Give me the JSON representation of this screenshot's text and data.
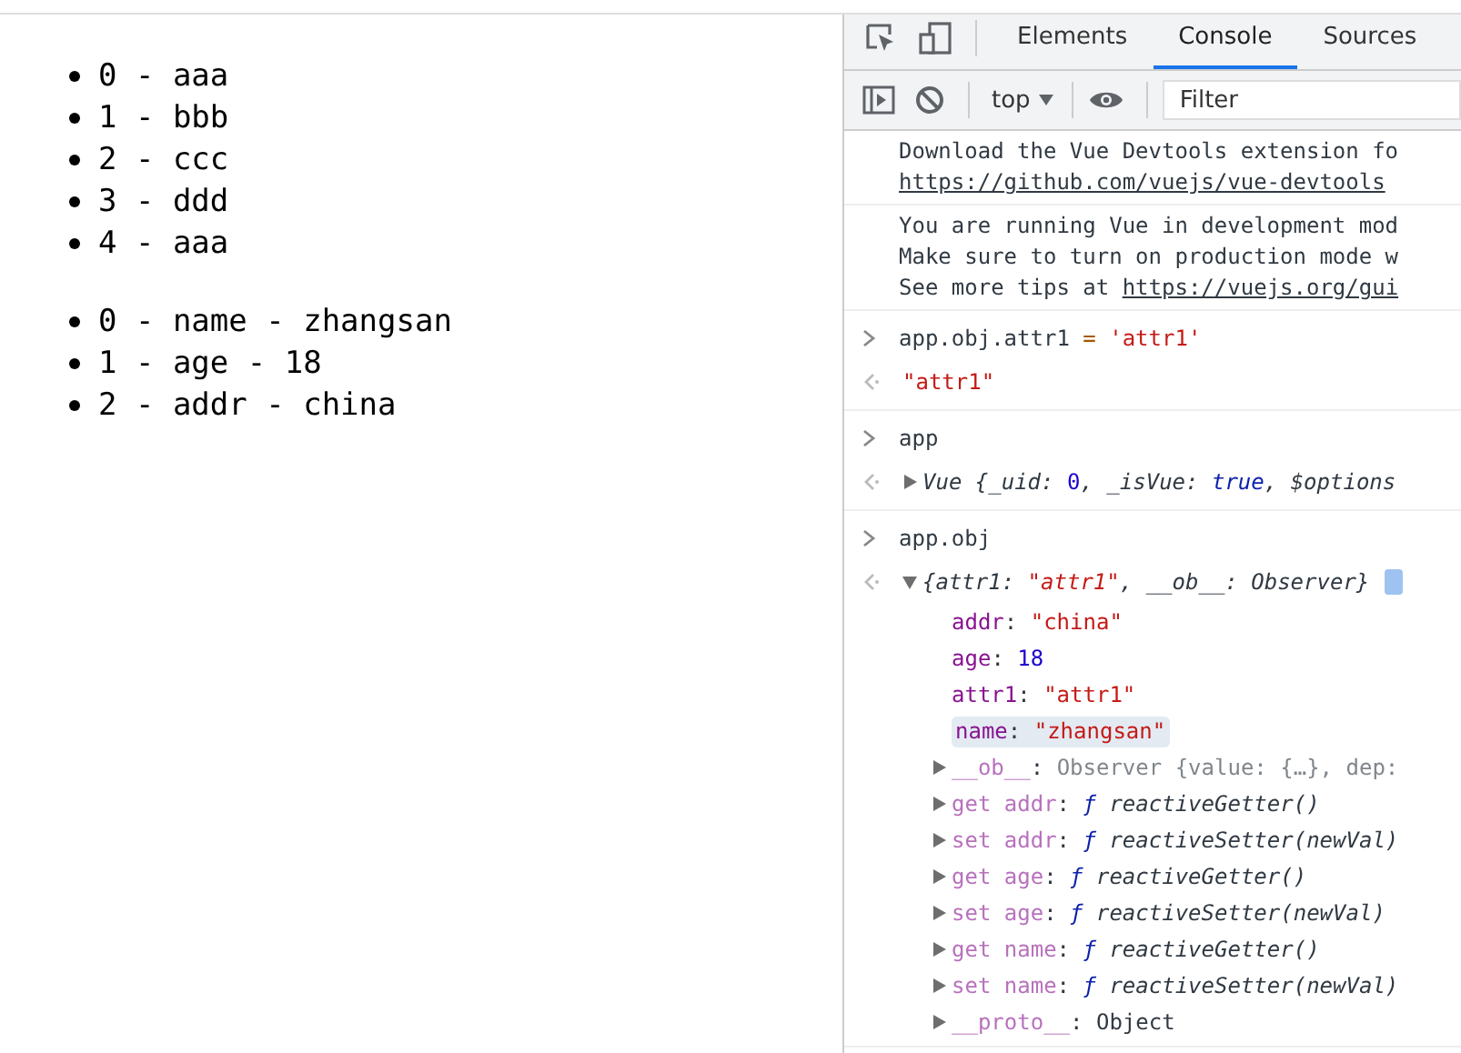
{
  "page": {
    "lists": [
      [
        "0 - aaa",
        "1 - bbb",
        "2 - ccc",
        "3 - ddd",
        "4 - aaa"
      ],
      [
        "0 - name - zhangsan",
        "1 - age - 18",
        "2 - addr - china"
      ]
    ]
  },
  "devtools": {
    "tabs": [
      {
        "label": "Elements",
        "selected": false
      },
      {
        "label": "Console",
        "selected": true
      },
      {
        "label": "Sources",
        "selected": false
      }
    ],
    "context": "top",
    "filter": {
      "placeholder": "Filter"
    },
    "entries": [
      {
        "kind": "message",
        "lines": [
          [
            {
              "kind": "plain",
              "text": "Download the Vue Devtools extension fo"
            }
          ],
          [
            {
              "kind": "link",
              "text": "https://github.com/vuejs/vue-devtools"
            }
          ]
        ]
      },
      {
        "kind": "message",
        "lines": [
          [
            {
              "kind": "plain",
              "text": "You are running Vue in development mod"
            }
          ],
          [
            {
              "kind": "plain",
              "text": "Make sure to turn on production mode w"
            }
          ],
          [
            {
              "kind": "plain",
              "text": "See more tips at "
            },
            {
              "kind": "link",
              "text": "https://vuejs.org/gui"
            }
          ]
        ]
      },
      {
        "kind": "command",
        "input": [
          {
            "kind": "plain",
            "text": "app.obj.attr1 "
          },
          {
            "kind": "operator",
            "text": "= "
          },
          {
            "kind": "string",
            "text": "'attr1'"
          }
        ],
        "result": {
          "expandable": false,
          "tokens": [
            {
              "kind": "string",
              "text": "\"attr1\""
            }
          ]
        }
      },
      {
        "kind": "command",
        "input": [
          {
            "kind": "plain",
            "text": "app"
          }
        ],
        "result": {
          "expandable": true,
          "expanded": false,
          "tokens": [
            {
              "kind": "italic",
              "text": "Vue {_uid: "
            },
            {
              "kind": "number",
              "text": "0"
            },
            {
              "kind": "italic",
              "text": ", _isVue: "
            },
            {
              "kind": "keyword",
              "text": "true"
            },
            {
              "kind": "italic",
              "text": ", $options"
            }
          ]
        }
      },
      {
        "kind": "command",
        "input": [
          {
            "kind": "plain",
            "text": "app.obj"
          }
        ],
        "result": {
          "expandable": true,
          "expanded": true,
          "info_badge": true,
          "tokens": [
            {
              "kind": "italic",
              "text": "{attr1: "
            },
            {
              "kind": "istring",
              "text": "\"attr1\""
            },
            {
              "kind": "italic",
              "text": ", __ob__: Observer}"
            }
          ],
          "children": [
            {
              "expandable": false,
              "highlighted": false,
              "tokens": [
                {
                  "kind": "key",
                  "text": "addr"
                },
                {
                  "kind": "plain",
                  "text": ": "
                },
                {
                  "kind": "string",
                  "text": "\"china\""
                }
              ]
            },
            {
              "expandable": false,
              "highlighted": false,
              "tokens": [
                {
                  "kind": "key",
                  "text": "age"
                },
                {
                  "kind": "plain",
                  "text": ": "
                },
                {
                  "kind": "number",
                  "text": "18"
                }
              ]
            },
            {
              "expandable": false,
              "highlighted": false,
              "tokens": [
                {
                  "kind": "key",
                  "text": "attr1"
                },
                {
                  "kind": "plain",
                  "text": ": "
                },
                {
                  "kind": "string",
                  "text": "\"attr1\""
                }
              ]
            },
            {
              "expandable": false,
              "highlighted": true,
              "tokens": [
                {
                  "kind": "key",
                  "text": "name"
                },
                {
                  "kind": "plain",
                  "text": ": "
                },
                {
                  "kind": "string",
                  "text": "\"zhangsan\""
                }
              ]
            },
            {
              "expandable": true,
              "highlighted": false,
              "tokens": [
                {
                  "kind": "dimkey",
                  "text": "__ob__"
                },
                {
                  "kind": "plain",
                  "text": ": "
                },
                {
                  "kind": "dim",
                  "text": "Observer {value: {…}, dep:"
                }
              ]
            },
            {
              "expandable": true,
              "highlighted": false,
              "tokens": [
                {
                  "kind": "dimkey",
                  "text": "get addr"
                },
                {
                  "kind": "plain",
                  "text": ": "
                },
                {
                  "kind": "func",
                  "text": "ƒ "
                },
                {
                  "kind": "italic",
                  "text": "reactiveGetter()"
                }
              ]
            },
            {
              "expandable": true,
              "highlighted": false,
              "tokens": [
                {
                  "kind": "dimkey",
                  "text": "set addr"
                },
                {
                  "kind": "plain",
                  "text": ": "
                },
                {
                  "kind": "func",
                  "text": "ƒ "
                },
                {
                  "kind": "italic",
                  "text": "reactiveSetter(newVal)"
                }
              ]
            },
            {
              "expandable": true,
              "highlighted": false,
              "tokens": [
                {
                  "kind": "dimkey",
                  "text": "get age"
                },
                {
                  "kind": "plain",
                  "text": ": "
                },
                {
                  "kind": "func",
                  "text": "ƒ "
                },
                {
                  "kind": "italic",
                  "text": "reactiveGetter()"
                }
              ]
            },
            {
              "expandable": true,
              "highlighted": false,
              "tokens": [
                {
                  "kind": "dimkey",
                  "text": "set age"
                },
                {
                  "kind": "plain",
                  "text": ": "
                },
                {
                  "kind": "func",
                  "text": "ƒ "
                },
                {
                  "kind": "italic",
                  "text": "reactiveSetter(newVal)"
                }
              ]
            },
            {
              "expandable": true,
              "highlighted": false,
              "tokens": [
                {
                  "kind": "dimkey",
                  "text": "get name"
                },
                {
                  "kind": "plain",
                  "text": ": "
                },
                {
                  "kind": "func",
                  "text": "ƒ "
                },
                {
                  "kind": "italic",
                  "text": "reactiveGetter()"
                }
              ]
            },
            {
              "expandable": true,
              "highlighted": false,
              "tokens": [
                {
                  "kind": "dimkey",
                  "text": "set name"
                },
                {
                  "kind": "plain",
                  "text": ": "
                },
                {
                  "kind": "func",
                  "text": "ƒ "
                },
                {
                  "kind": "italic",
                  "text": "reactiveSetter(newVal)"
                }
              ]
            },
            {
              "expandable": true,
              "highlighted": false,
              "tokens": [
                {
                  "kind": "dimkey",
                  "text": "__proto__"
                },
                {
                  "kind": "plain",
                  "text": ": "
                },
                {
                  "kind": "plain",
                  "text": "Object"
                }
              ]
            }
          ]
        }
      }
    ]
  }
}
